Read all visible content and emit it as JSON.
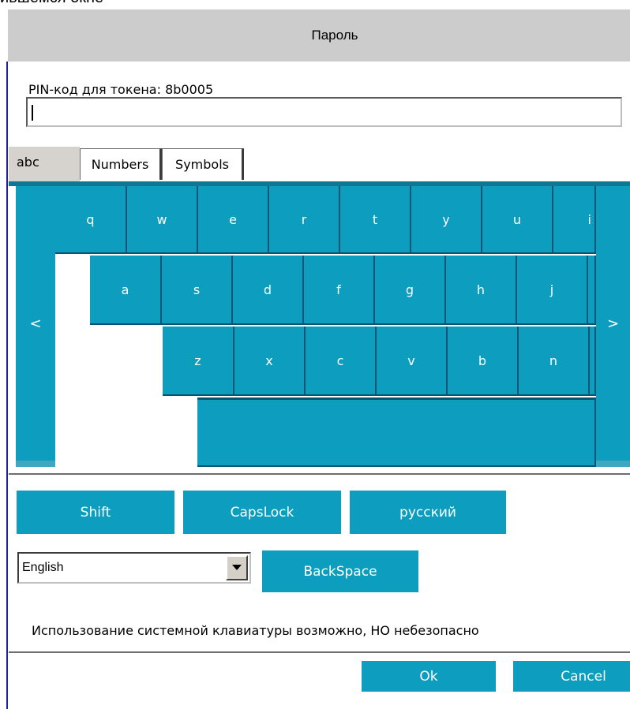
{
  "window": {
    "cut_text": "ившемся окне",
    "title": "Пароль"
  },
  "pin": {
    "label": "PIN-код для токена: 8b0005",
    "value": ""
  },
  "tabs": [
    {
      "label": "abc",
      "active": true
    },
    {
      "label": "Numbers",
      "active": false
    },
    {
      "label": "Symbols",
      "active": false
    }
  ],
  "keyboard": {
    "nav_left": "<",
    "nav_right": ">",
    "row1": [
      "q",
      "w",
      "e",
      "r",
      "t",
      "y",
      "u",
      "i"
    ],
    "row2": [
      "a",
      "s",
      "d",
      "f",
      "g",
      "h",
      "j"
    ],
    "row3": [
      "z",
      "x",
      "c",
      "v",
      "b",
      "n"
    ],
    "space": ""
  },
  "buttons": {
    "shift": "Shift",
    "capslock": "CapsLock",
    "lang": "русский",
    "backspace": "BackSpace",
    "ok": "Ok",
    "cancel": "Cancel"
  },
  "language_select": {
    "value": "English"
  },
  "warning": "Использование системной клавиатуры возможно, НО небезопасно",
  "colors": {
    "key": "#0d9dbe",
    "title_bar": "#cccccc"
  }
}
